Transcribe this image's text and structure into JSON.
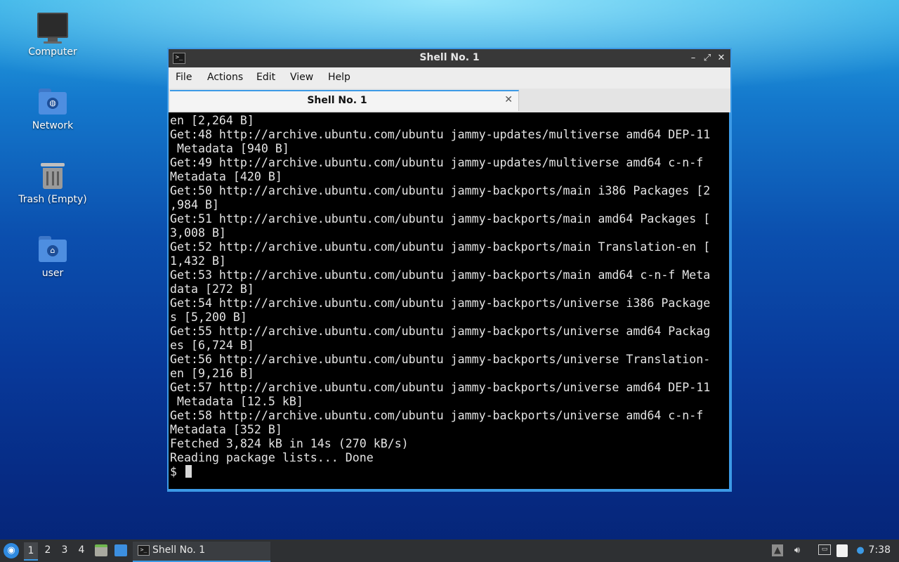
{
  "desktop": {
    "icons": [
      {
        "label": "Computer"
      },
      {
        "label": "Network"
      },
      {
        "label": "Trash (Empty)"
      },
      {
        "label": "user"
      }
    ]
  },
  "window": {
    "title": "Shell No. 1",
    "buttons": {
      "minimize": "–",
      "maximize": "⤢",
      "close": "✕"
    },
    "menu": [
      "File",
      "Actions",
      "Edit",
      "View",
      "Help"
    ],
    "tab": {
      "label": "Shell No. 1",
      "close": "✕"
    }
  },
  "terminal": {
    "lines": [
      "en [2,264 B]",
      "Get:48 http://archive.ubuntu.com/ubuntu jammy-updates/multiverse amd64 DEP-11",
      " Metadata [940 B]",
      "Get:49 http://archive.ubuntu.com/ubuntu jammy-updates/multiverse amd64 c-n-f",
      "Metadata [420 B]",
      "Get:50 http://archive.ubuntu.com/ubuntu jammy-backports/main i386 Packages [2",
      ",984 B]",
      "Get:51 http://archive.ubuntu.com/ubuntu jammy-backports/main amd64 Packages [",
      "3,008 B]",
      "Get:52 http://archive.ubuntu.com/ubuntu jammy-backports/main Translation-en [",
      "1,432 B]",
      "Get:53 http://archive.ubuntu.com/ubuntu jammy-backports/main amd64 c-n-f Meta",
      "data [272 B]",
      "Get:54 http://archive.ubuntu.com/ubuntu jammy-backports/universe i386 Package",
      "s [5,200 B]",
      "Get:55 http://archive.ubuntu.com/ubuntu jammy-backports/universe amd64 Packag",
      "es [6,724 B]",
      "Get:56 http://archive.ubuntu.com/ubuntu jammy-backports/universe Translation-",
      "en [9,216 B]",
      "Get:57 http://archive.ubuntu.com/ubuntu jammy-backports/universe amd64 DEP-11",
      " Metadata [12.5 kB]",
      "Get:58 http://archive.ubuntu.com/ubuntu jammy-backports/universe amd64 c-n-f",
      "Metadata [352 B]",
      "Fetched 3,824 kB in 14s (270 kB/s)",
      "Reading package lists... Done",
      "$ "
    ]
  },
  "taskbar": {
    "workspaces": [
      "1",
      "2",
      "3",
      "4"
    ],
    "task_label": "Shell No. 1",
    "clock": "7:38"
  }
}
